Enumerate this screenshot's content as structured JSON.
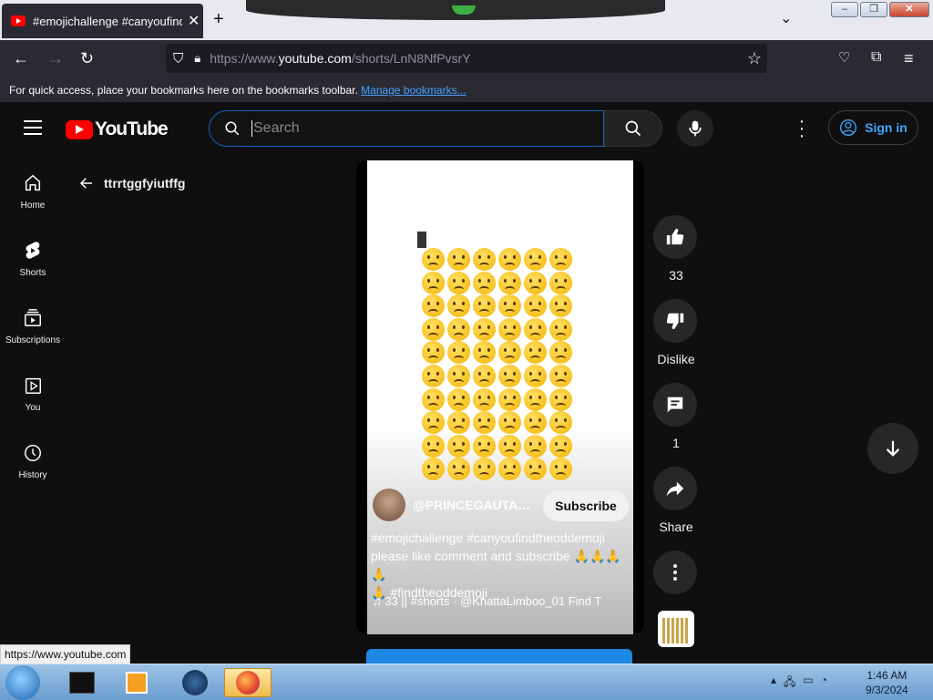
{
  "browser": {
    "tab_title": "#emojichallenge #canyoufindth",
    "tab_close": "✕",
    "new_tab": "+",
    "url_prefix": "https://www.",
    "url_host": "youtube.com",
    "url_path": "/shorts/LnN8NfPvsrY",
    "bookmarks_message": "For quick access, place your bookmarks here on the bookmarks toolbar.",
    "manage_bookmarks": "Manage bookmarks...",
    "status_url": "https://www.youtube.com"
  },
  "youtube": {
    "logo_text": "YouTube",
    "search_placeholder": "Search",
    "sign_in": "Sign in",
    "sidebar": [
      {
        "label": "Home"
      },
      {
        "label": "Shorts"
      },
      {
        "label": "Subscriptions"
      },
      {
        "label": "You"
      },
      {
        "label": "History"
      }
    ],
    "back_title": "ttrrtggfyiutffg",
    "short": {
      "channel": "@PRINCEGAUTAM-...",
      "subscribe": "Subscribe",
      "caption_line1": "#emojichallenge #canyoufindtheoddemoji",
      "caption_line2": "please like comment and subscribe 🙏🙏🙏🙏",
      "caption_line3": "🙏 #findtheoddemoji",
      "music": "♫ 33 || #shorts · @KhattaLimboo_01   Find T",
      "emoji_rows": 10,
      "emoji_cols": 6
    },
    "actions": {
      "likes": "33",
      "dislike": "Dislike",
      "comments": "1",
      "share": "Share"
    }
  },
  "taskbar": {
    "time": "1:46 AM",
    "date": "9/3/2024"
  },
  "colors": {
    "accent_blue": "#3ea6ff",
    "youtube_red": "#ff0000",
    "background": "#0f0f0f"
  }
}
